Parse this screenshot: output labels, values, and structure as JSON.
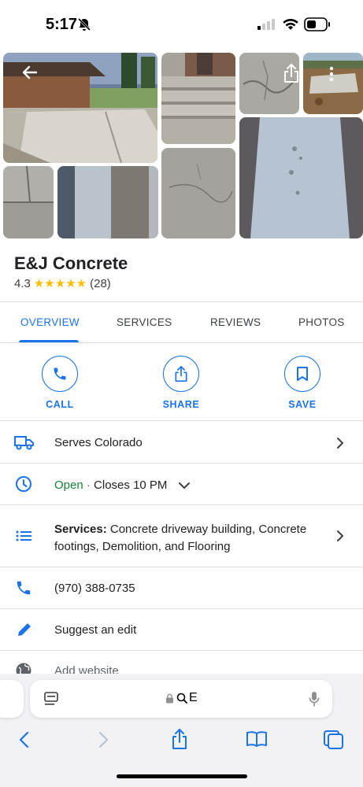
{
  "status_bar": {
    "time": "5:17"
  },
  "business": {
    "name": "E&J Concrete",
    "rating": "4.3",
    "stars": "★★★★★",
    "review_count": "(28)"
  },
  "tabs": [
    {
      "label": "OVERVIEW",
      "active": true
    },
    {
      "label": "SERVICES"
    },
    {
      "label": "REVIEWS"
    },
    {
      "label": "PHOTOS"
    }
  ],
  "actions": [
    {
      "label": "CALL",
      "icon": "phone-icon"
    },
    {
      "label": "SHARE",
      "icon": "share-icon"
    },
    {
      "label": "SAVE",
      "icon": "bookmark-icon"
    }
  ],
  "info": {
    "serves": "Serves Colorado",
    "hours_open": "Open",
    "hours_sep": " · ",
    "hours_close": "Closes 10 PM",
    "services_label": "Services:",
    "services_line1": " Concrete driveway building, Concrete",
    "services_line2": "footings, Demolition, and Flooring",
    "phone": "(970) 388-0735",
    "suggest": "Suggest an edit",
    "website": "Add website"
  },
  "browser": {
    "url_text": "E"
  },
  "colors": {
    "accent": "#1a73e8",
    "open_green": "#188038",
    "star": "#fbbc04"
  }
}
